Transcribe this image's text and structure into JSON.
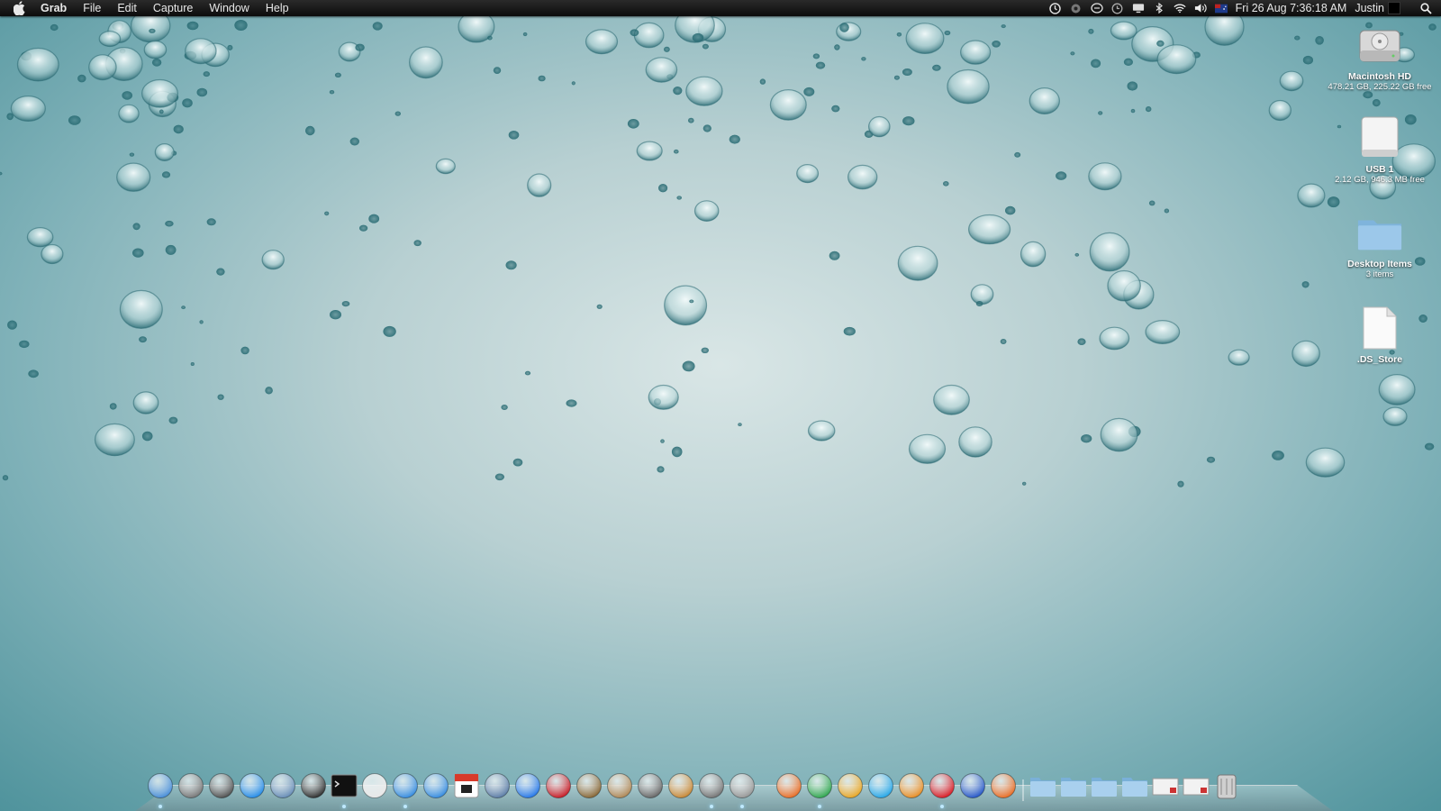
{
  "menubar": {
    "app_name": "Grab",
    "menus": [
      "File",
      "Edit",
      "Capture",
      "Window",
      "Help"
    ],
    "clock": "Fri 26 Aug  7:36:18 AM",
    "user": "Justin",
    "status_icons": [
      "time-machine-icon",
      "sync-icon",
      "messages-icon",
      "history-icon",
      "display-icon",
      "bluetooth-icon",
      "wifi-icon",
      "volume-icon",
      "flag-icon"
    ]
  },
  "desktop": {
    "items": [
      {
        "name": "Macintosh HD",
        "sub": "478.21 GB, 225.22 GB free",
        "icon": "hard-drive-icon"
      },
      {
        "name": "USB 1",
        "sub": "2.12 GB, 946.3 MB free",
        "icon": "usb-drive-icon"
      },
      {
        "name": "Desktop Items",
        "sub": "3 items",
        "icon": "folder-icon"
      },
      {
        "name": ".DS_Store",
        "sub": "",
        "icon": "document-icon"
      }
    ]
  },
  "dock": {
    "apps": [
      {
        "name": "finder-icon",
        "color": "#4a8fd8",
        "running": true
      },
      {
        "name": "launchpad-icon",
        "color": "#7a7a7a"
      },
      {
        "name": "activity-monitor-icon",
        "color": "#555555"
      },
      {
        "name": "app-store-icon",
        "color": "#2a8ee8"
      },
      {
        "name": "xcode-icon",
        "color": "#6a8fb8"
      },
      {
        "name": "dvd-player-icon",
        "color": "#333333"
      },
      {
        "name": "terminal-icon",
        "color": "#111111",
        "running": true
      },
      {
        "name": "textedit-icon",
        "color": "#e8e8e8"
      },
      {
        "name": "ichat-icon",
        "color": "#3a8ee0",
        "running": true
      },
      {
        "name": "safari-icon",
        "color": "#3a8ee0"
      },
      {
        "name": "ical-icon",
        "color": "#d83a2a"
      },
      {
        "name": "preview-icon",
        "color": "#5f7fa8"
      },
      {
        "name": "itunes-icon",
        "color": "#2a7ae8"
      },
      {
        "name": "photo-booth-icon",
        "color": "#c8202a"
      },
      {
        "name": "image-capture-icon",
        "color": "#8a6a3a"
      },
      {
        "name": "keynote-icon",
        "color": "#b08a5a"
      },
      {
        "name": "imovie-icon",
        "color": "#6a6a6a"
      },
      {
        "name": "garageband-icon",
        "color": "#c88a3a"
      },
      {
        "name": "system-preferences-icon",
        "color": "#777777",
        "running": true
      },
      {
        "name": "grab-icon",
        "color": "#999999",
        "running": true
      },
      {
        "name": "spacer",
        "color": ""
      },
      {
        "name": "firefox-icon",
        "color": "#e8702a"
      },
      {
        "name": "chrome-icon",
        "color": "#34a853",
        "running": true
      },
      {
        "name": "picasa-icon",
        "color": "#e8a82a"
      },
      {
        "name": "skype-icon",
        "color": "#2aa8e8"
      },
      {
        "name": "scratch-icon",
        "color": "#e8902a"
      },
      {
        "name": "angry-birds-icon",
        "color": "#d8202a",
        "running": true
      },
      {
        "name": "word-icon",
        "color": "#2a5ac8"
      },
      {
        "name": "powerpoint-icon",
        "color": "#e8702a"
      },
      {
        "name": "divider",
        "color": ""
      },
      {
        "name": "applications-folder-icon",
        "color": "#7ab0d8"
      },
      {
        "name": "documents-folder-icon",
        "color": "#7ab0d8"
      },
      {
        "name": "downloads-folder-icon",
        "color": "#7ab0d8"
      },
      {
        "name": "stack-folder-icon",
        "color": "#7ab0d8"
      },
      {
        "name": "mail-stack-icon",
        "color": "#e8e8e8"
      },
      {
        "name": "mail-stack-icon",
        "color": "#e8e8e8"
      },
      {
        "name": "trash-icon",
        "color": "#9a9a9a"
      }
    ]
  },
  "colors": {
    "menubar": "#111111",
    "wallpaper_center": "#d9e6e6",
    "wallpaper_edge": "#4f939c"
  }
}
